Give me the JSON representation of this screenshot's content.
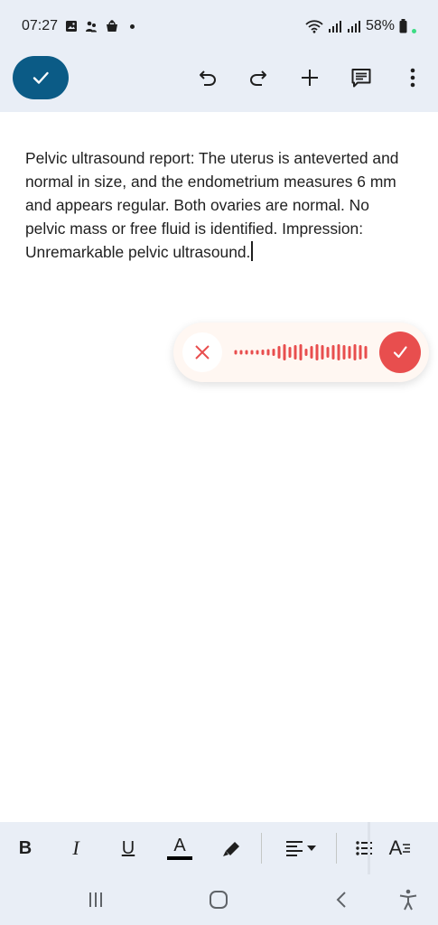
{
  "status_bar": {
    "time": "07:27",
    "battery": "58%",
    "left_icons": [
      "gallery-icon",
      "people-icon",
      "bag-icon",
      "more-dot-icon"
    ],
    "right_icons": [
      "wifi-icon",
      "signal-icon",
      "signal-icon",
      "battery-icon"
    ]
  },
  "toolbar": {
    "buttons": [
      "done-check",
      "undo",
      "redo",
      "insert",
      "comment",
      "more-vert"
    ]
  },
  "document": {
    "text": " Pelvic ultrasound report: The uterus is anteverted and normal in size, and the endometrium measures 6 mm and appears regular. Both ovaries are normal. No pelvic mass or free fluid is identified. Impression: Unremarkable pelvic ultrasound."
  },
  "voice_input": {
    "accent_color": "#e84e4e",
    "background": "#fff7f2"
  },
  "format_bar": {
    "bold": "B",
    "italic": "I",
    "underline": "U",
    "text_color": "A",
    "text_style": "A"
  },
  "colors": {
    "bar_background": "#e9eef6",
    "primary": "#0b5b86"
  }
}
